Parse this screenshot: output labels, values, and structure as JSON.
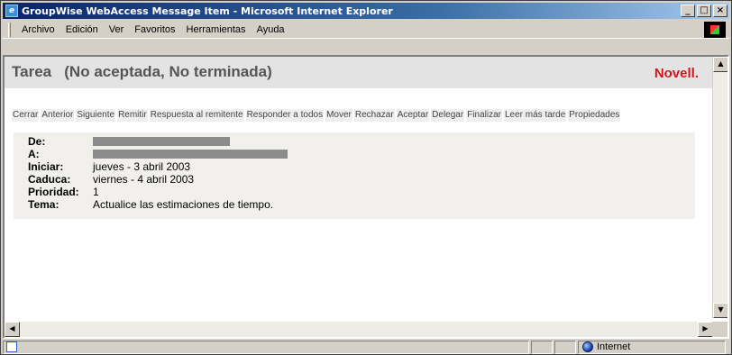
{
  "window": {
    "title": "GroupWise WebAccess Message Item - Microsoft Internet Explorer",
    "buttons": {
      "minimize": "_",
      "maximize": "□",
      "close": "×"
    }
  },
  "menu": {
    "items": [
      "Archivo",
      "Edición",
      "Ver",
      "Favoritos",
      "Herramientas",
      "Ayuda"
    ]
  },
  "header": {
    "title": "Tarea   (No aceptada, No terminada)",
    "logo": "Novell."
  },
  "toolbar": {
    "buttons": [
      "Cerrar",
      "Anterior",
      "Siguiente",
      "Remitir",
      "Respuesta al remitente",
      "Responder a todos",
      "Mover",
      "Rechazar",
      "Aceptar",
      "Delegar",
      "Finalizar",
      "Leer más tarde",
      "Propiedades"
    ]
  },
  "fields": {
    "from_label": "De:",
    "to_label": "A:",
    "start_label": "Iniciar:",
    "start_value": "jueves - 3 abril 2003",
    "due_label": "Caduca:",
    "due_value": "viernes - 4 abril 2003",
    "priority_label": "Prioridad:",
    "priority_value": "1",
    "subject_label": "Tema:",
    "subject_value": "Actualice las estimaciones de tiempo."
  },
  "status": {
    "zone": "Internet"
  },
  "icons": [
    "ie-app-icon",
    "windows-throbber-icon",
    "scroll-up-icon",
    "scroll-down-icon",
    "scroll-left-icon",
    "scroll-right-icon",
    "page-icon",
    "globe-icon"
  ]
}
